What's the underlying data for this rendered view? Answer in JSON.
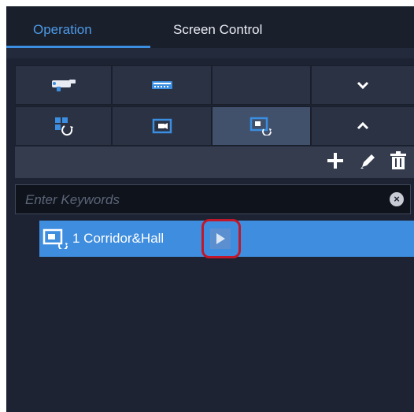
{
  "tabs": [
    {
      "label": "Operation",
      "active": true
    },
    {
      "label": "Screen Control",
      "active": false
    }
  ],
  "device_grid": {
    "rows": [
      [
        {
          "icon": "camera-icon"
        },
        {
          "icon": "encoder-device-icon"
        },
        {
          "icon": ""
        },
        {
          "icon": "chevron-down-icon"
        }
      ],
      [
        {
          "icon": "layout-cycle-icon"
        },
        {
          "icon": "single-screen-icon"
        },
        {
          "icon": "screen-cycle-icon",
          "selected": true
        },
        {
          "icon": "chevron-up-icon"
        }
      ]
    ]
  },
  "toolbar": {
    "add_icon": "plus-icon",
    "edit_icon": "pencil-icon",
    "delete_icon": "trash-icon"
  },
  "search": {
    "placeholder": "Enter Keywords",
    "value": ""
  },
  "list": {
    "items": [
      {
        "label": "1 Corridor&Hall",
        "icon": "screen-cycle-icon",
        "action_icon": "play-icon",
        "selected": true
      }
    ]
  },
  "colors": {
    "panel_bg": "#1d2333",
    "accent": "#3b8ee0",
    "selected_row": "#3f8ddf",
    "highlight_outline": "#c0182a"
  }
}
